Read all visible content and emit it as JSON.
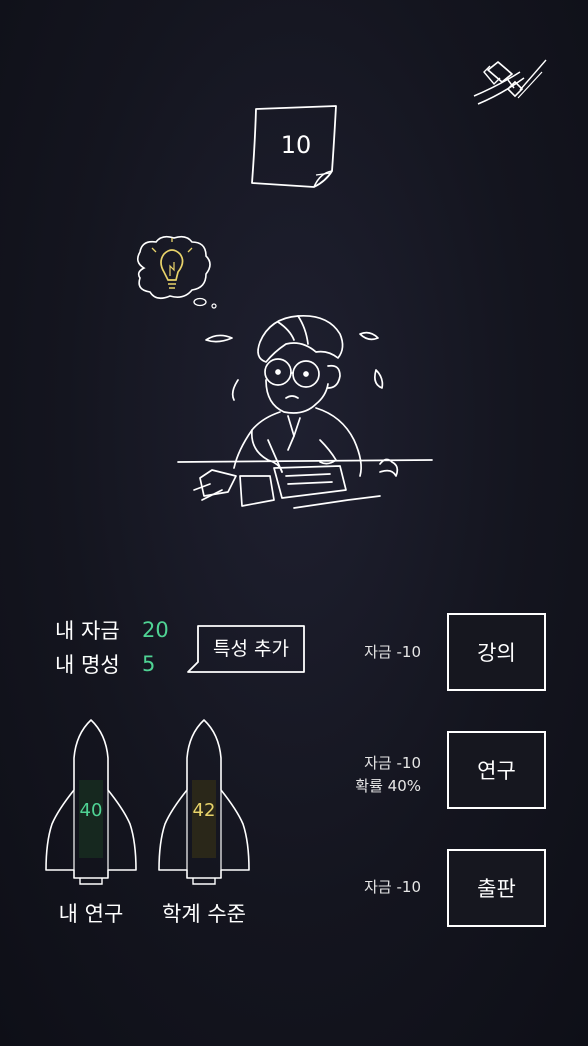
{
  "turn_counter": "10",
  "stats": {
    "funds_label": "내 자금",
    "funds_value": "20",
    "fame_label": "내 명성",
    "fame_value": "5"
  },
  "trait_button_label": "특성 추가",
  "rockets": [
    {
      "value": "40",
      "label": "내 연구",
      "value_color": "#4fd394",
      "fill_color": "#16281f"
    },
    {
      "value": "42",
      "label": "학계 수준",
      "value_color": "#e8d36a",
      "fill_color": "#2a2719"
    }
  ],
  "actions": [
    {
      "cost": "자금 -10",
      "probability": "",
      "label": "강의"
    },
    {
      "cost": "자금 -10",
      "probability": "확률 40%",
      "label": "연구"
    },
    {
      "cost": "자금 -10",
      "probability": "",
      "label": "출판"
    }
  ],
  "icons": {
    "settings": "hammer-wrench-icon",
    "idea": "lightbulb-icon",
    "turn": "sticky-note-icon"
  },
  "colors": {
    "background": "#14151f",
    "accent_green": "#4fd394",
    "accent_yellow": "#e8d36a",
    "line": "#ffffff"
  }
}
